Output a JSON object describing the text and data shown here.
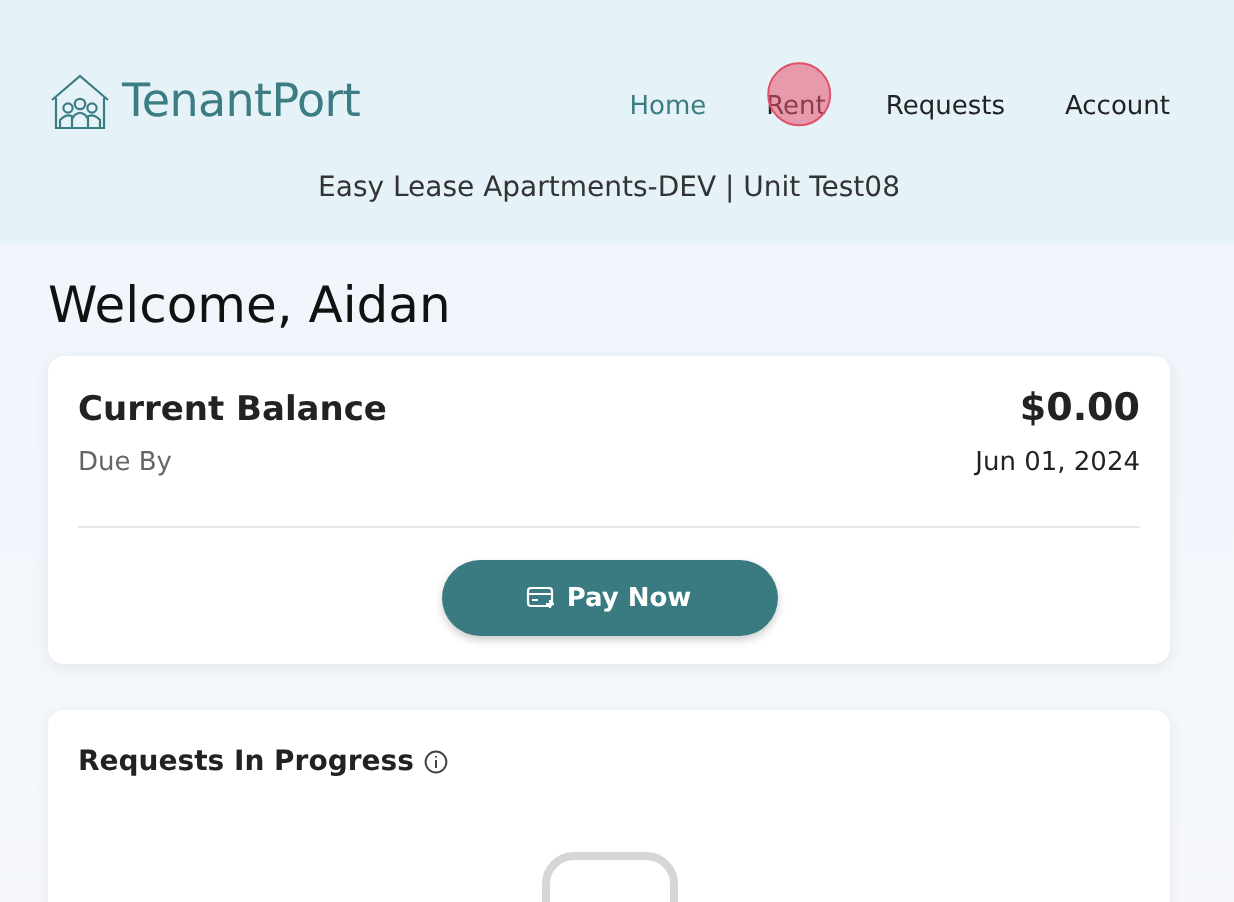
{
  "header": {
    "brand": "TenantPort",
    "nav": [
      {
        "label": "Home",
        "selected": true,
        "tapped": false
      },
      {
        "label": "Rent",
        "selected": false,
        "tapped": true
      },
      {
        "label": "Requests",
        "selected": false,
        "tapped": false
      },
      {
        "label": "Account",
        "selected": false,
        "tapped": false
      }
    ],
    "property": "Easy Lease Apartments-DEV | Unit Test08"
  },
  "welcome": "Welcome, Aidan",
  "balance_card": {
    "title": "Current Balance",
    "amount": "$0.00",
    "due_label": "Due By",
    "due_date": "Jun 01, 2024",
    "button": "Pay Now"
  },
  "requests_card": {
    "title": "Requests In Progress"
  }
}
